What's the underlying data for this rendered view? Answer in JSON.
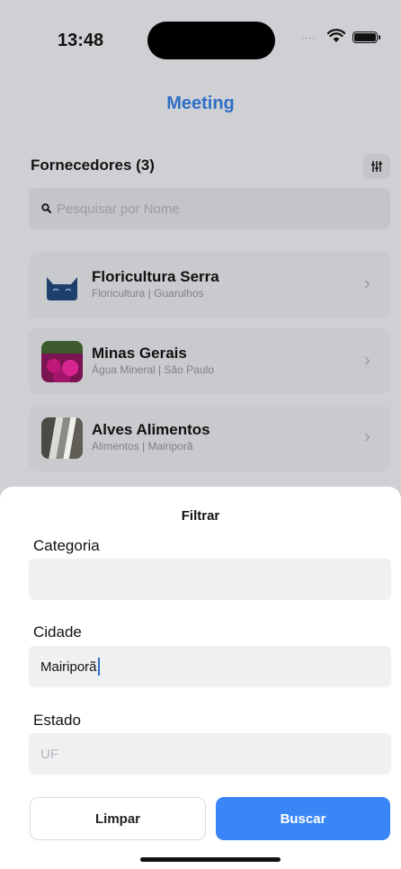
{
  "status_bar": {
    "time": "13:48",
    "signal": "....",
    "icons": [
      "wifi-icon",
      "battery-icon"
    ]
  },
  "nav": {
    "title": "Meeting"
  },
  "list": {
    "header": "Fornecedores (3)",
    "filter_icon": "sliders-icon",
    "search": {
      "placeholder": "Pesquisar por Nome",
      "value": ""
    },
    "items": [
      {
        "name": "Floricultura Serra",
        "subtitle": "Floricultura | Guarulhos",
        "image": "cat-avatar"
      },
      {
        "name": "Minas Gerais",
        "subtitle": "Água Mineral | São Paulo",
        "image": "flower-field-photo"
      },
      {
        "name": "Alves Alimentos",
        "subtitle": "Alimentos | Mairiporã",
        "image": "waterfall-photo"
      }
    ]
  },
  "sheet": {
    "title": "Filtrar",
    "fields": {
      "category": {
        "label": "Categoria",
        "value": "",
        "placeholder": ""
      },
      "city": {
        "label": "Cidade",
        "value": "Mairiporã"
      },
      "state": {
        "label": "Estado",
        "value": "",
        "placeholder": "UF"
      }
    },
    "buttons": {
      "clear": "Limpar",
      "search": "Buscar"
    }
  },
  "colors": {
    "accent": "#3a86f7",
    "nav_title": "#2f6fc6",
    "dim_background": "#ced0d3"
  }
}
